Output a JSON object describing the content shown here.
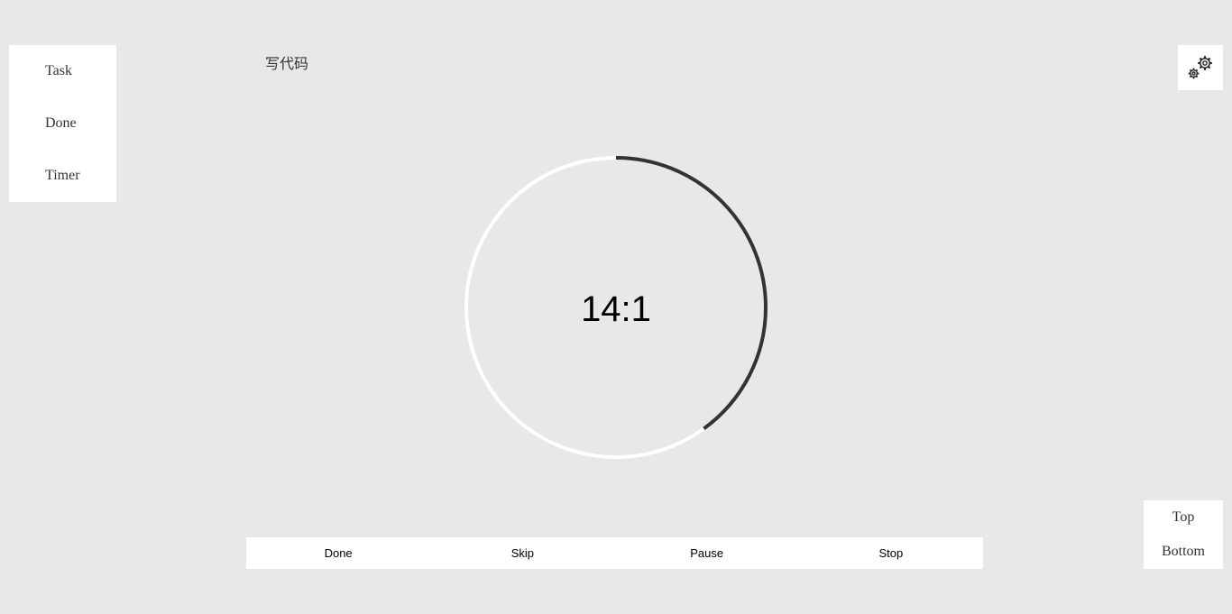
{
  "nav": {
    "items": [
      {
        "label": "Task"
      },
      {
        "label": "Done"
      },
      {
        "label": "Timer"
      }
    ]
  },
  "task": {
    "title": "写代码"
  },
  "settings": {
    "icon": "gears-icon"
  },
  "timer": {
    "display": "14:1",
    "progress_fraction": 0.4,
    "progress_color": "#333333",
    "track_color": "#ffffff"
  },
  "controls": {
    "done_label": "Done",
    "skip_label": "Skip",
    "pause_label": "Pause",
    "stop_label": "Stop"
  },
  "scroll": {
    "top_label": "Top",
    "bottom_label": "Bottom"
  },
  "colors": {
    "background": "#e8e8e8",
    "card": "#ffffff",
    "text": "#333333"
  }
}
